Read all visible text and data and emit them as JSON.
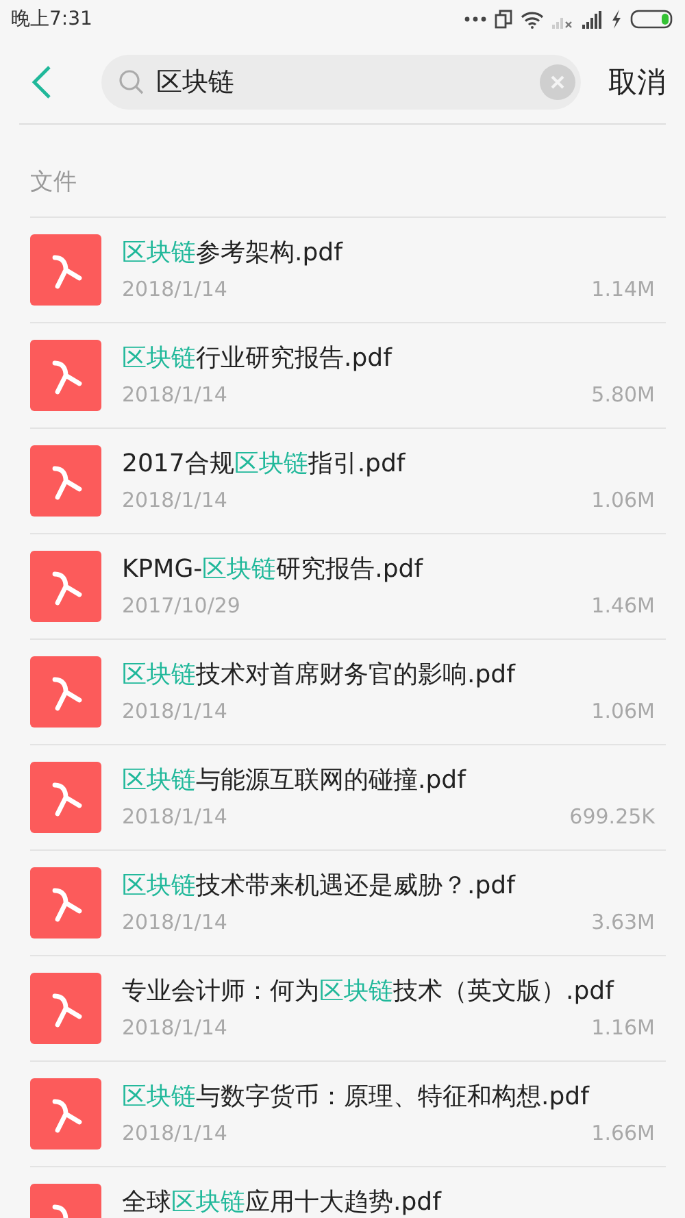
{
  "status_bar": {
    "time": "晚上7:31"
  },
  "search": {
    "value": "区块链",
    "cancel": "取消"
  },
  "section": {
    "title": "文件"
  },
  "files": [
    {
      "name": [
        {
          "text": "区块链",
          "highlighted": true
        },
        {
          "text": "参考架构.pdf",
          "highlighted": false
        }
      ],
      "date": "2018/1/14",
      "size": "1.14M"
    },
    {
      "name": [
        {
          "text": "区块链",
          "highlighted": true
        },
        {
          "text": "行业研究报告.pdf",
          "highlighted": false
        }
      ],
      "date": "2018/1/14",
      "size": "5.80M"
    },
    {
      "name": [
        {
          "text": "2017合规",
          "highlighted": false
        },
        {
          "text": "区块链",
          "highlighted": true
        },
        {
          "text": "指引.pdf",
          "highlighted": false
        }
      ],
      "date": "2018/1/14",
      "size": "1.06M"
    },
    {
      "name": [
        {
          "text": "KPMG-",
          "highlighted": false
        },
        {
          "text": "区块链",
          "highlighted": true
        },
        {
          "text": "研究报告.pdf",
          "highlighted": false
        }
      ],
      "date": "2017/10/29",
      "size": "1.46M"
    },
    {
      "name": [
        {
          "text": "区块链",
          "highlighted": true
        },
        {
          "text": "技术对首席财务官的影响.pdf",
          "highlighted": false
        }
      ],
      "date": "2018/1/14",
      "size": "1.06M"
    },
    {
      "name": [
        {
          "text": "区块链",
          "highlighted": true
        },
        {
          "text": "与能源互联网的碰撞.pdf",
          "highlighted": false
        }
      ],
      "date": "2018/1/14",
      "size": "699.25K"
    },
    {
      "name": [
        {
          "text": "区块链",
          "highlighted": true
        },
        {
          "text": "技术带来机遇还是威胁？.pdf",
          "highlighted": false
        }
      ],
      "date": "2018/1/14",
      "size": "3.63M"
    },
    {
      "name": [
        {
          "text": "专业会计师：何为",
          "highlighted": false
        },
        {
          "text": "区块链",
          "highlighted": true
        },
        {
          "text": "技术（英文版）.pdf",
          "highlighted": false
        }
      ],
      "date": "2018/1/14",
      "size": "1.16M"
    },
    {
      "name": [
        {
          "text": "区块链",
          "highlighted": true
        },
        {
          "text": "与数字货币：原理、特征和构想.pdf",
          "highlighted": false
        }
      ],
      "date": "2018/1/14",
      "size": "1.66M"
    },
    {
      "name": [
        {
          "text": "全球",
          "highlighted": false
        },
        {
          "text": "区块链",
          "highlighted": true
        },
        {
          "text": "应用十大趋势.pdf",
          "highlighted": false
        }
      ]
    }
  ]
}
